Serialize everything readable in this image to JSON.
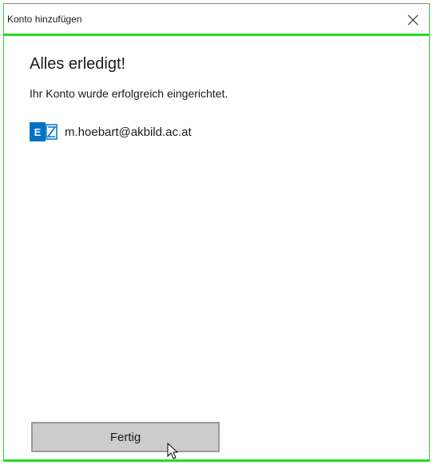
{
  "window": {
    "title": "Konto hinzufügen",
    "close_icon": "close-icon"
  },
  "content": {
    "heading": "Alles erledigt!",
    "message": "Ihr Konto wurde erfolgreich eingerichtet.",
    "account": {
      "icon": "exchange-icon",
      "icon_letter": "E",
      "email": "m.hoebart@akbild.ac.at"
    }
  },
  "footer": {
    "done_label": "Fertig"
  },
  "colors": {
    "focus_border": "#22dd22",
    "exchange_blue": "#0072c6",
    "button_bg": "#cccccc"
  }
}
